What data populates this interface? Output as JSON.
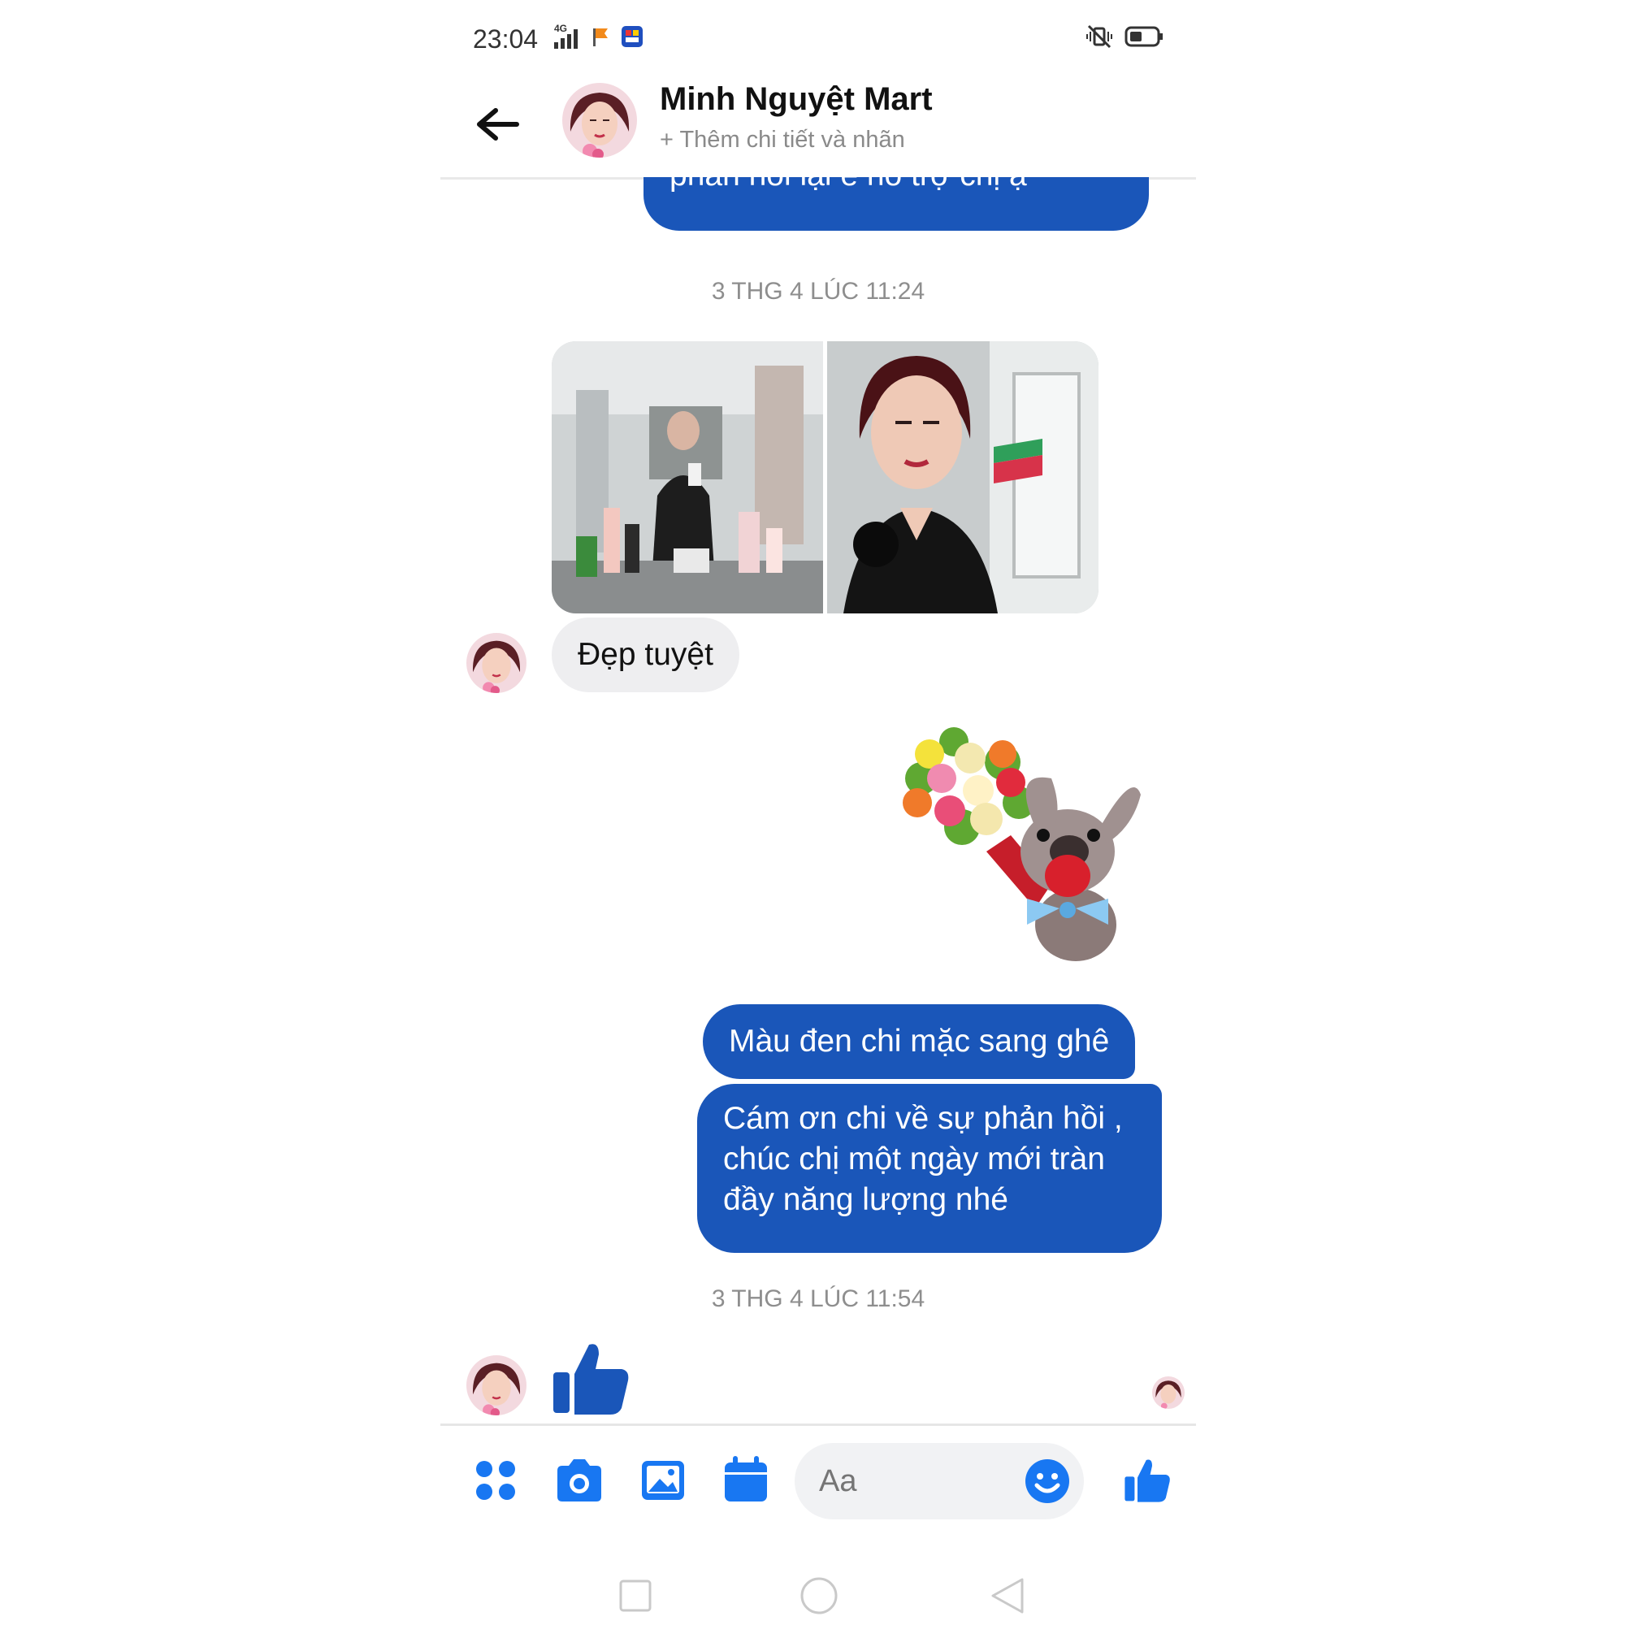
{
  "status_bar": {
    "time": "23:04",
    "network": "4G",
    "icons": [
      "signal-icon",
      "flag-icon",
      "app-notification-icon",
      "vibrate-off-icon",
      "battery-icon"
    ]
  },
  "header": {
    "contact_name": "Minh Nguyệt Mart",
    "subtitle": "+ Thêm chi tiết và nhãn"
  },
  "messages": {
    "partial_top": "phản hồi lại e hỗ trợ chị ạ",
    "timestamp_1": "3 THG 4 LÚC 11:24",
    "incoming_text": "Đẹp tuyệt",
    "outgoing_1": "Màu đen chi mặc sang ghê",
    "outgoing_2_line1": "Cám ơn chi về sự phản hồi ,",
    "outgoing_2_line2": "chúc chị một ngày mới tràn",
    "outgoing_2_line3": "đầy năng lượng nhé",
    "timestamp_2": "3 THG 4 LÚC 11:54"
  },
  "composer": {
    "placeholder": "Aa",
    "icons": [
      "apps-icon",
      "camera-icon",
      "gallery-icon",
      "calendar-icon",
      "emoji-icon",
      "like-icon"
    ]
  },
  "nav_bar": {
    "icons": [
      "recent-apps-icon",
      "home-icon",
      "back-triangle-icon"
    ]
  },
  "colors": {
    "accent": "#1a56b9",
    "messenger_blue": "#1877f2",
    "incoming_bubble": "#eeeef0"
  }
}
